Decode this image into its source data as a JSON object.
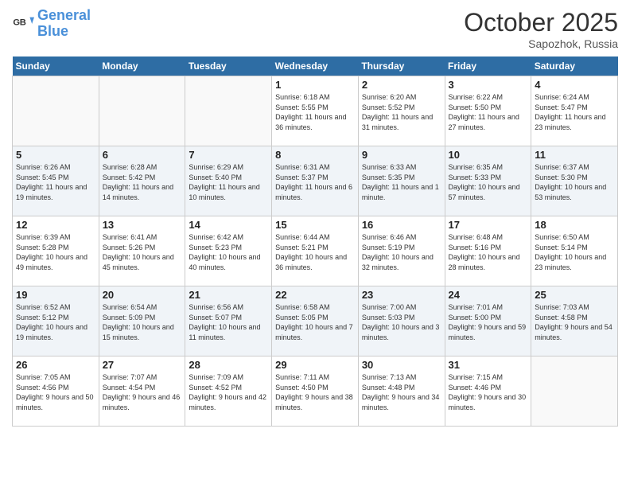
{
  "header": {
    "logo_line1": "General",
    "logo_line2": "Blue",
    "month": "October 2025",
    "location": "Sapozhok, Russia"
  },
  "days_of_week": [
    "Sunday",
    "Monday",
    "Tuesday",
    "Wednesday",
    "Thursday",
    "Friday",
    "Saturday"
  ],
  "weeks": [
    [
      {
        "day": "",
        "sunrise": "",
        "sunset": "",
        "daylight": ""
      },
      {
        "day": "",
        "sunrise": "",
        "sunset": "",
        "daylight": ""
      },
      {
        "day": "",
        "sunrise": "",
        "sunset": "",
        "daylight": ""
      },
      {
        "day": "1",
        "sunrise": "Sunrise: 6:18 AM",
        "sunset": "Sunset: 5:55 PM",
        "daylight": "Daylight: 11 hours and 36 minutes."
      },
      {
        "day": "2",
        "sunrise": "Sunrise: 6:20 AM",
        "sunset": "Sunset: 5:52 PM",
        "daylight": "Daylight: 11 hours and 31 minutes."
      },
      {
        "day": "3",
        "sunrise": "Sunrise: 6:22 AM",
        "sunset": "Sunset: 5:50 PM",
        "daylight": "Daylight: 11 hours and 27 minutes."
      },
      {
        "day": "4",
        "sunrise": "Sunrise: 6:24 AM",
        "sunset": "Sunset: 5:47 PM",
        "daylight": "Daylight: 11 hours and 23 minutes."
      }
    ],
    [
      {
        "day": "5",
        "sunrise": "Sunrise: 6:26 AM",
        "sunset": "Sunset: 5:45 PM",
        "daylight": "Daylight: 11 hours and 19 minutes."
      },
      {
        "day": "6",
        "sunrise": "Sunrise: 6:28 AM",
        "sunset": "Sunset: 5:42 PM",
        "daylight": "Daylight: 11 hours and 14 minutes."
      },
      {
        "day": "7",
        "sunrise": "Sunrise: 6:29 AM",
        "sunset": "Sunset: 5:40 PM",
        "daylight": "Daylight: 11 hours and 10 minutes."
      },
      {
        "day": "8",
        "sunrise": "Sunrise: 6:31 AM",
        "sunset": "Sunset: 5:37 PM",
        "daylight": "Daylight: 11 hours and 6 minutes."
      },
      {
        "day": "9",
        "sunrise": "Sunrise: 6:33 AM",
        "sunset": "Sunset: 5:35 PM",
        "daylight": "Daylight: 11 hours and 1 minute."
      },
      {
        "day": "10",
        "sunrise": "Sunrise: 6:35 AM",
        "sunset": "Sunset: 5:33 PM",
        "daylight": "Daylight: 10 hours and 57 minutes."
      },
      {
        "day": "11",
        "sunrise": "Sunrise: 6:37 AM",
        "sunset": "Sunset: 5:30 PM",
        "daylight": "Daylight: 10 hours and 53 minutes."
      }
    ],
    [
      {
        "day": "12",
        "sunrise": "Sunrise: 6:39 AM",
        "sunset": "Sunset: 5:28 PM",
        "daylight": "Daylight: 10 hours and 49 minutes."
      },
      {
        "day": "13",
        "sunrise": "Sunrise: 6:41 AM",
        "sunset": "Sunset: 5:26 PM",
        "daylight": "Daylight: 10 hours and 45 minutes."
      },
      {
        "day": "14",
        "sunrise": "Sunrise: 6:42 AM",
        "sunset": "Sunset: 5:23 PM",
        "daylight": "Daylight: 10 hours and 40 minutes."
      },
      {
        "day": "15",
        "sunrise": "Sunrise: 6:44 AM",
        "sunset": "Sunset: 5:21 PM",
        "daylight": "Daylight: 10 hours and 36 minutes."
      },
      {
        "day": "16",
        "sunrise": "Sunrise: 6:46 AM",
        "sunset": "Sunset: 5:19 PM",
        "daylight": "Daylight: 10 hours and 32 minutes."
      },
      {
        "day": "17",
        "sunrise": "Sunrise: 6:48 AM",
        "sunset": "Sunset: 5:16 PM",
        "daylight": "Daylight: 10 hours and 28 minutes."
      },
      {
        "day": "18",
        "sunrise": "Sunrise: 6:50 AM",
        "sunset": "Sunset: 5:14 PM",
        "daylight": "Daylight: 10 hours and 23 minutes."
      }
    ],
    [
      {
        "day": "19",
        "sunrise": "Sunrise: 6:52 AM",
        "sunset": "Sunset: 5:12 PM",
        "daylight": "Daylight: 10 hours and 19 minutes."
      },
      {
        "day": "20",
        "sunrise": "Sunrise: 6:54 AM",
        "sunset": "Sunset: 5:09 PM",
        "daylight": "Daylight: 10 hours and 15 minutes."
      },
      {
        "day": "21",
        "sunrise": "Sunrise: 6:56 AM",
        "sunset": "Sunset: 5:07 PM",
        "daylight": "Daylight: 10 hours and 11 minutes."
      },
      {
        "day": "22",
        "sunrise": "Sunrise: 6:58 AM",
        "sunset": "Sunset: 5:05 PM",
        "daylight": "Daylight: 10 hours and 7 minutes."
      },
      {
        "day": "23",
        "sunrise": "Sunrise: 7:00 AM",
        "sunset": "Sunset: 5:03 PM",
        "daylight": "Daylight: 10 hours and 3 minutes."
      },
      {
        "day": "24",
        "sunrise": "Sunrise: 7:01 AM",
        "sunset": "Sunset: 5:00 PM",
        "daylight": "Daylight: 9 hours and 59 minutes."
      },
      {
        "day": "25",
        "sunrise": "Sunrise: 7:03 AM",
        "sunset": "Sunset: 4:58 PM",
        "daylight": "Daylight: 9 hours and 54 minutes."
      }
    ],
    [
      {
        "day": "26",
        "sunrise": "Sunrise: 7:05 AM",
        "sunset": "Sunset: 4:56 PM",
        "daylight": "Daylight: 9 hours and 50 minutes."
      },
      {
        "day": "27",
        "sunrise": "Sunrise: 7:07 AM",
        "sunset": "Sunset: 4:54 PM",
        "daylight": "Daylight: 9 hours and 46 minutes."
      },
      {
        "day": "28",
        "sunrise": "Sunrise: 7:09 AM",
        "sunset": "Sunset: 4:52 PM",
        "daylight": "Daylight: 9 hours and 42 minutes."
      },
      {
        "day": "29",
        "sunrise": "Sunrise: 7:11 AM",
        "sunset": "Sunset: 4:50 PM",
        "daylight": "Daylight: 9 hours and 38 minutes."
      },
      {
        "day": "30",
        "sunrise": "Sunrise: 7:13 AM",
        "sunset": "Sunset: 4:48 PM",
        "daylight": "Daylight: 9 hours and 34 minutes."
      },
      {
        "day": "31",
        "sunrise": "Sunrise: 7:15 AM",
        "sunset": "Sunset: 4:46 PM",
        "daylight": "Daylight: 9 hours and 30 minutes."
      },
      {
        "day": "",
        "sunrise": "",
        "sunset": "",
        "daylight": ""
      }
    ]
  ]
}
